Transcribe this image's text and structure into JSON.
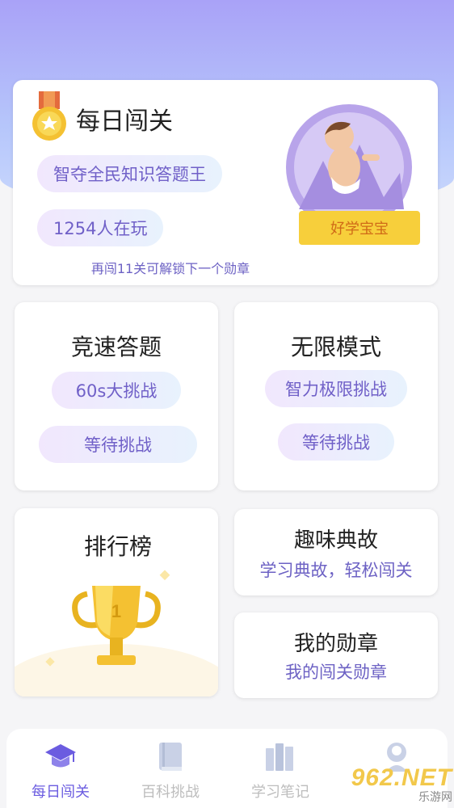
{
  "daily": {
    "title": "每日闯关",
    "slogan": "智夺全民知识答题王",
    "players": "1254人在玩",
    "unlock_tip": "再闯11关可解锁下一个勋章",
    "badge_label": "好学宝宝"
  },
  "race": {
    "title": "竞速答题",
    "pill1": "60s大挑战",
    "pill2": "等待挑战"
  },
  "infinite": {
    "title": "无限模式",
    "pill1": "智力极限挑战",
    "pill2": "等待挑战"
  },
  "rank": {
    "title": "排行榜"
  },
  "story": {
    "title": "趣味典故",
    "subtitle": "学习典故，轻松闯关"
  },
  "medals": {
    "title": "我的勋章",
    "subtitle": "我的闯关勋章"
  },
  "tabs": [
    {
      "label": "每日闯关",
      "icon": "graduation-cap-icon"
    },
    {
      "label": "百科挑战",
      "icon": "book-icon"
    },
    {
      "label": "学习笔记",
      "icon": "books-icon"
    },
    {
      "label": "",
      "icon": "profile-icon"
    }
  ],
  "watermark": {
    "main": "962.NET",
    "sub": "乐游网"
  },
  "colors": {
    "accent": "#6b5ce0",
    "pill_text": "#7060c8",
    "badge_yellow": "#f7cf3b"
  }
}
